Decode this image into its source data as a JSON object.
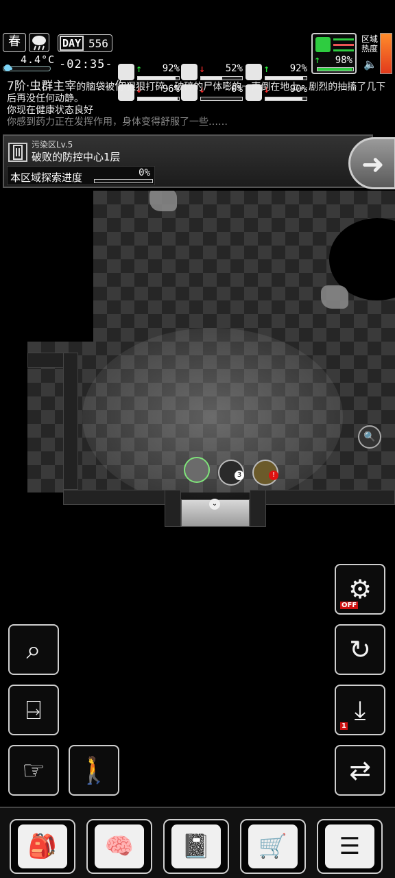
{
  "hud": {
    "season": "春",
    "temperature": "4.4°C",
    "temperature_level": 0.18,
    "day_label": "DAY",
    "day_number": "556",
    "clock": "-02:35-",
    "stats": [
      {
        "name": "health",
        "icon": "medkit-icon",
        "trend": "up",
        "arrow": "↑",
        "value": "92%",
        "level": 0.92
      },
      {
        "name": "hunger",
        "icon": "stomach-icon",
        "trend": "down",
        "arrow": "↓",
        "value": "52%",
        "level": 0.52
      },
      {
        "name": "armor",
        "icon": "helmet-icon",
        "trend": "up",
        "arrow": "↑",
        "value": "92%",
        "level": 0.92
      },
      {
        "name": "sanity",
        "icon": "brain-icon",
        "trend": "down",
        "arrow": "↓",
        "value": "96%",
        "level": 0.96
      },
      {
        "name": "bleeding",
        "icon": "blood-drop-icon",
        "trend": "down",
        "arrow": "↓",
        "value": "0%",
        "level": 0.0
      },
      {
        "name": "mood",
        "icon": "heart-icon",
        "trend": "down",
        "arrow": "↓",
        "value": "90%",
        "level": 0.9
      }
    ],
    "stamina": {
      "icon": "boot-icon",
      "arrow": "↑",
      "value": "98%",
      "level": 0.98
    },
    "region_heat_label": "区域热度",
    "colors": {
      "up": "#27e33a",
      "down": "#ff2b2b",
      "heat": "#ff8c2b",
      "temp": "#7bd3f5"
    }
  },
  "log": {
    "line1_enemy": "7阶·虫群主宰",
    "line1_mid": "的脑袋被",
    "line1_you": "你",
    "line1_rest": "狠狠打碎，破碎的尸体嘭的一声倒在地上，剧烈的抽搐了几下后再没任何动静。",
    "line2": "你现在健康状态良好",
    "line3": "你感到药力正在发挥作用，身体变得舒服了一些……"
  },
  "location": {
    "zone_level": "污染区Lv.5",
    "zone_name": "破败的防控中心1层",
    "explore_label": "本区域探索进度",
    "explore_percent": "0%",
    "explore_level": 0.0
  },
  "map": {
    "player": {
      "name": "player-token"
    },
    "enemy_badge": "3",
    "npc_badge": "!",
    "search_node_icon": "🔍"
  },
  "actions": {
    "right": [
      {
        "name": "auto-attack-toggle-button",
        "icon": "turret-off-icon",
        "badge": "OFF"
      },
      {
        "name": "special-attack-button",
        "icon": "turret-arc-icon"
      },
      {
        "name": "floor-map-button",
        "icon": "map-level-icon",
        "badge": "1"
      },
      {
        "name": "stance-switch-button",
        "icon": "soldier-switch-icon"
      }
    ],
    "left": [
      {
        "name": "search-area-button",
        "icon": "search-pin-icon"
      },
      {
        "name": "exit-area-button",
        "icon": "exit-door-icon"
      },
      {
        "name": "tap-move-button",
        "icon": "tap-arrow-icon"
      },
      {
        "name": "walk-mode-button",
        "icon": "walking-person-icon"
      }
    ]
  },
  "bottom_menu": [
    {
      "name": "backpack-button",
      "icon": "backpack-icon",
      "glyph": "🎒"
    },
    {
      "name": "skills-button",
      "icon": "brain-head-icon",
      "glyph": "🧠"
    },
    {
      "name": "journal-button",
      "icon": "notebook-icon",
      "glyph": "📓"
    },
    {
      "name": "shop-button",
      "icon": "cart-icon",
      "glyph": "🛒"
    },
    {
      "name": "main-menu-button",
      "icon": "list-menu-icon",
      "glyph": "☰"
    }
  ]
}
